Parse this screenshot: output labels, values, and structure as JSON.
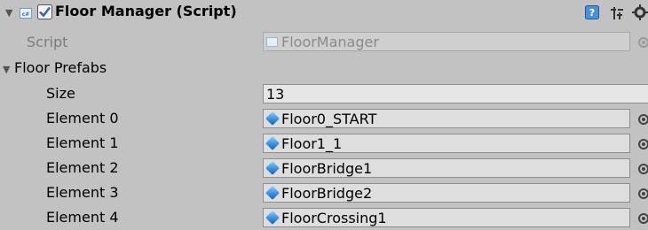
{
  "component": {
    "title": "Floor Manager (Script)",
    "script_label": "Script",
    "script_value": "FloorManager",
    "icons": [
      "help-book-icon",
      "preset-icon",
      "gear-icon",
      "script-file-icon",
      "checkbox-icon",
      "prefab-cube-icon",
      "object-picker-icon"
    ]
  },
  "floor_prefabs": {
    "label": "Floor Prefabs",
    "size_label": "Size",
    "size_value": "13",
    "elements": [
      {
        "label": "Element 0",
        "value": "Floor0_START"
      },
      {
        "label": "Element 1",
        "value": "Floor1_1"
      },
      {
        "label": "Element 2",
        "value": "FloorBridge1"
      },
      {
        "label": "Element 3",
        "value": "FloorBridge2"
      },
      {
        "label": "Element 4",
        "value": "FloorCrossing1"
      }
    ]
  },
  "colors": {
    "background": "#c2c2c2",
    "field": "#dedede",
    "checkbox": "#3a64b4"
  }
}
